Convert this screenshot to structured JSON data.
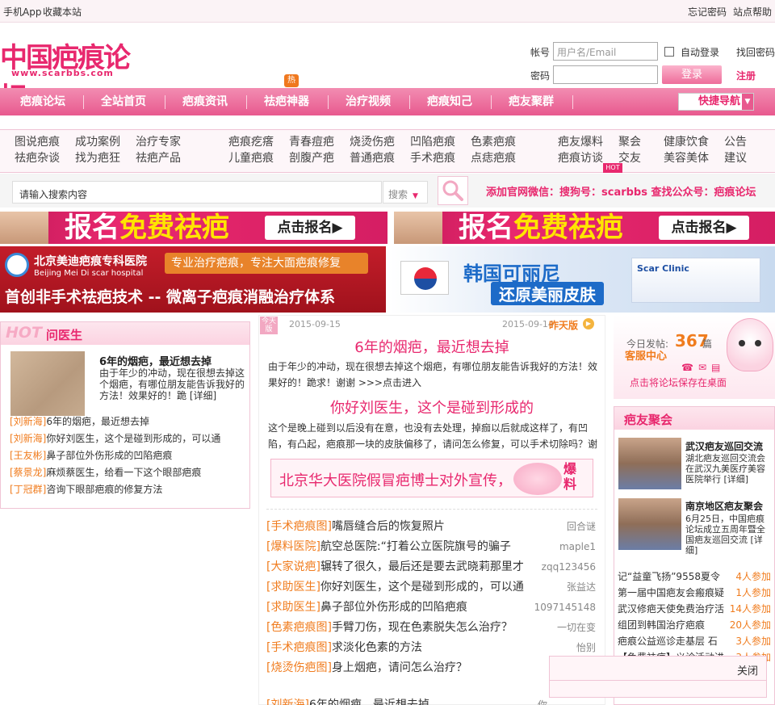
{
  "topbar": {
    "mobile_app": "手机App",
    "bookmark": "收藏本站",
    "forgot_password": "忘记密码",
    "help": "站点帮助"
  },
  "logo": {
    "title": "中国疤痕论坛",
    "url": "www.scarbbs.com"
  },
  "login": {
    "account_label": "帐号",
    "account_placeholder": "用户名/Email",
    "auto_login": "自动登录",
    "find_password": "找回密码",
    "password_label": "密码",
    "login_button": "登录",
    "register": "注册"
  },
  "nav": {
    "hot_badge": "热",
    "items": [
      "疤痕论坛",
      "全站首页",
      "疤痕资讯",
      "祛疤神器",
      "治疗视频",
      "疤痕知己",
      "疤友聚群"
    ],
    "quick_nav": "快捷导航"
  },
  "subnav": {
    "columns": [
      [
        "图说疤痕",
        "祛疤杂谈"
      ],
      [
        "成功案例",
        "找为疤狂"
      ],
      [
        "治疗专家",
        "祛疤产品"
      ],
      [
        "疤痕疙瘩",
        "儿童疤痕"
      ],
      [
        "青春痘疤",
        "剖腹产疤"
      ],
      [
        "烧烫伤疤",
        "普通疤痕"
      ],
      [
        "凹陷疤痕",
        "手术疤痕"
      ],
      [
        "色素疤痕",
        "点痣疤痕"
      ],
      [
        "疤友爆料",
        "疤痕访谈"
      ],
      [
        "聚会",
        "交友"
      ],
      [
        "健康饮食",
        "美容美体"
      ],
      [
        "公告",
        "建议"
      ]
    ],
    "hot_badge": "HOT"
  },
  "search": {
    "placeholder": "请输入搜索内容",
    "type": "搜索",
    "tagline": "添加官网微信：搜狗号：scarbbs 查找公众号：疤痕论坛"
  },
  "banners": {
    "signup_left": {
      "text_a": "报名",
      "text_b": "免费祛疤",
      "cta": "点击报名▶"
    },
    "signup_right": {
      "text_a": "报名",
      "text_b": "免费祛疤",
      "cta": "点击报名▶"
    },
    "meidi": {
      "hospital": "北京美迪疤痕专科医院",
      "hospital_en": "Beijing Mei Di scar hospital",
      "slogan": "专业治疗疤痕，专注大面疤痕修复",
      "headline": "首创非手术祛疤技术 -- 微离子疤痕消融治疗体系"
    },
    "korea": {
      "line1": "韩国可丽尼",
      "line2": "还原美丽皮肤",
      "product": "Scar Clinic"
    }
  },
  "ask_doctor": {
    "hot": "HOT",
    "title": "问医生",
    "featured_title": "6年的烟疤，最近想去掉",
    "featured_body": "由于年少的冲动，现在很想去掉这个烟疤，有哪位朋友能告诉我好的方法！效果好的！跪 [详细]",
    "items": [
      {
        "tag": "[刘新海]",
        "text": "6年的烟疤，最近想去掉"
      },
      {
        "tag": "[刘新海]",
        "text": "你好刘医生，这个是碰到形成的，可以通"
      },
      {
        "tag": "[王友彬]",
        "text": "鼻子部位外伤形成的凹陷疤痕"
      },
      {
        "tag": "[蔡景龙]",
        "text": "麻烦蔡医生，给看一下这个眼部疤痕"
      },
      {
        "tag": "[丁冠群]",
        "text": "咨询下眼部疤痕的修复方法"
      }
    ]
  },
  "center": {
    "stamp": "今天版",
    "date_left": "2015-09-15",
    "date_right": "2015-09-14",
    "yesterday": "昨天版",
    "post1_title": "6年的烟疤，最近想去掉",
    "post1_body": "由于年少的冲动，现在很想去掉这个烟疤，有哪位朋友能告诉我好的方法！效果好的！跪求！谢谢 >>>点击进入",
    "post2_title": "你好刘医生，这个是碰到形成的",
    "post2_body": "这个是晚上碰到以后没有在意，也没有去处理，掉痂以后就成这样了，有凹陷，有凸起，疤痕那一块的皮肤偏移了，请问怎么修复，可以手术切除吗？谢",
    "alert": "北京华大医院假冒疤博士对外宣传，",
    "alert_badge": "爆料",
    "threads": [
      {
        "tag": "[手术疤痕图]",
        "title": "嘴唇缝合后的恢复照片",
        "author": "回合谜"
      },
      {
        "tag": "[爆料医院]",
        "title": "航空总医院:“打着公立医院旗号的骗子",
        "author": "maple1"
      },
      {
        "tag": "[大家说疤]",
        "title": "辗转了很久，最后还是要去武晓莉那里才",
        "author": "zqq123456"
      },
      {
        "tag": "[求助医生]",
        "title": "你好刘医生，这个是碰到形成的，可以通",
        "author": "张益达"
      },
      {
        "tag": "[求助医生]",
        "title": "鼻子部位外伤形成的凹陷疤痕",
        "author": "1097145148"
      },
      {
        "tag": "[色素疤痕图]",
        "title": "手臂刀伤，现在色素脱失怎么治疗？",
        "author": "一切在变"
      },
      {
        "tag": "[手术疤痕图]",
        "title": "求淡化色素的方法",
        "author": "怡别"
      },
      {
        "tag": "[烧烫伤疤图]",
        "title": "身上烟疤，请问怎么治疗？",
        "author": ""
      },
      {
        "tag": "[刘新海]",
        "title": "6年的烟疤，最近想去掉",
        "author": "你"
      }
    ]
  },
  "right": {
    "today_posts_label": "今日发帖:",
    "today_posts": "367",
    "today_posts_unit": "篇",
    "service": "客服中心",
    "save_desktop": "点击将论坛保存在桌面",
    "group_title": "疤友聚会",
    "events": [
      {
        "title": "武汉疤友巡回交流",
        "text": "湖北疤友巡回交流会在武汉九美医疗美容医院举行 [详细]"
      },
      {
        "title": "南京地区疤友聚会",
        "text": "6月25日，中国疤痕论坛成立五周年暨全国疤友巡回交流 [详细]"
      }
    ],
    "signups": [
      {
        "text": "记“益童飞扬”9558夏令",
        "count": "4人参加"
      },
      {
        "text": "第一届中国疤友会瘢痕疑",
        "count": "1人参加"
      },
      {
        "text": "武汉修疤天使免费治疗活",
        "count": "14人参加"
      },
      {
        "text": "组团到韩国治疗疤痕",
        "count": "20人参加"
      },
      {
        "text": "疤痕公益巡诊走基层 石",
        "count": "3人参加"
      },
      {
        "text": "【免费祛疤】义诊活动进",
        "count": "3人参加"
      }
    ]
  },
  "popup": {
    "close": "关闭"
  }
}
